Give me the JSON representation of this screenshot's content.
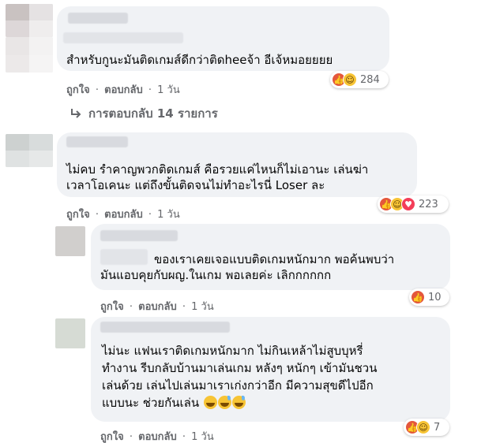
{
  "comments": [
    {
      "text_lines": [
        "สำหรับกูนะมันติดเกมส์ดีกว่าติดheeจ้า อีเจ้หมอยยยย"
      ],
      "actions": {
        "like": "ถูกใจ",
        "reply": "ตอบกลับ",
        "sep": "·",
        "time": "1 วัน"
      },
      "reactions": {
        "types": [
          "like-icon",
          "haha-icon"
        ],
        "count": "284"
      },
      "replies_link": "การตอบกลับ 14 รายการ"
    },
    {
      "text_lines": [
        "ไม่คบ รำคาญพวกติดเกมส์ คือรวยแค่ไหนก็ไม่เอานะ เล่นฆ่า",
        "เวลาโอเคนะ แต่ถึงขั้นติดจนไม่ทำอะไรนี่ Loser ละ"
      ],
      "actions": {
        "like": "ถูกใจ",
        "reply": "ตอบกลับ",
        "sep": "·",
        "time": "1 วัน"
      },
      "reactions": {
        "types": [
          "like-icon",
          "haha-icon",
          "love-icon"
        ],
        "count": "223"
      }
    },
    {
      "text_lines": [
        "ของเราเคยเจอแบบติดเกมหนักมาก พอค้นพบว่า",
        "มันแอบคุยกับผญ.ในเกม พอเลยค่ะ เลิกกกกกก"
      ],
      "actions": {
        "like": "ถูกใจ",
        "reply": "ตอบกลับ",
        "sep": "·",
        "time": "1 วัน"
      },
      "reactions": {
        "types": [
          "like-icon"
        ],
        "count": "10"
      }
    },
    {
      "text_lines": [
        "ไม่นะ แฟนเราติดเกมหนักมาก ไม่กินเหล้าไม่สูบบุหรี่",
        "ทำงาน รีบกลับบ้านมาเล่นเกม หลังๆ หนักๆ เข้ามันชวน",
        "เล่นด้วย เล่นไปเล่นมาเราเก่งกว่าอีก มีความสุขดีไปอีก",
        "แบบนะ ช่วยกันเล่น"
      ],
      "actions": {
        "like": "ถูกใจ",
        "reply": "ตอบกลับ",
        "sep": "·",
        "time": "1 วัน"
      },
      "reactions": {
        "types": [
          "like-icon",
          "haha-icon"
        ],
        "count": "7"
      }
    }
  ],
  "colors": {
    "bubble": "#f0f2f5",
    "meta": "#65676b",
    "like": "#e4573c",
    "haha": "#f7c435",
    "love": "#f33e58"
  }
}
